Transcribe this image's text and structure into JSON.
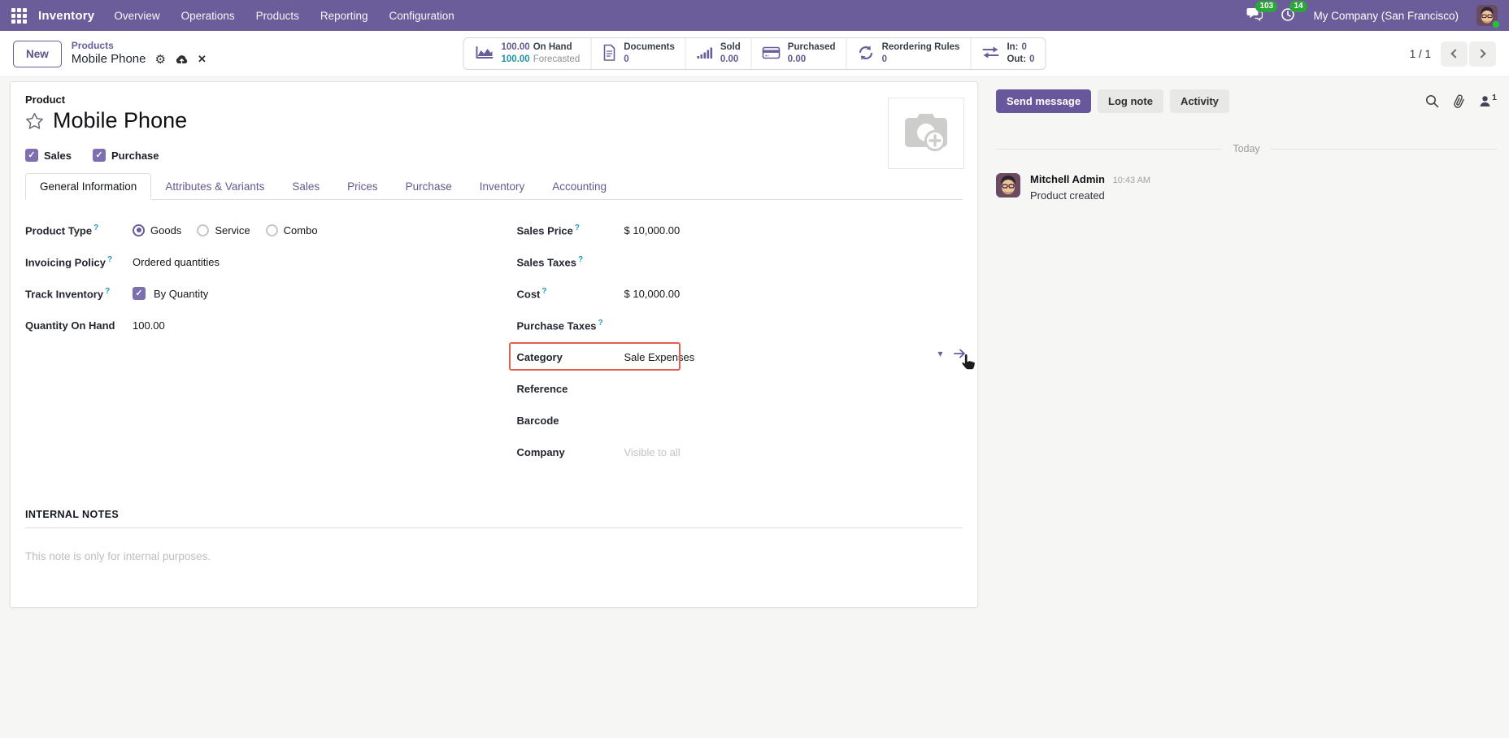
{
  "navbar": {
    "app_name": "Inventory",
    "menu_items": [
      "Overview",
      "Operations",
      "Products",
      "Reporting",
      "Configuration"
    ],
    "messages_badge": "103",
    "activities_badge": "14",
    "company_name": "My Company (San Francisco)"
  },
  "control_panel": {
    "new_button": "New",
    "breadcrumb": {
      "parent": "Products",
      "current": "Mobile Phone"
    },
    "pager": "1 / 1"
  },
  "stat_buttons": {
    "on_hand": {
      "value": "100.00",
      "label": "On Hand",
      "value2": "100.00",
      "label2": "Forecasted"
    },
    "documents": {
      "label": "Documents",
      "value": "0"
    },
    "sold": {
      "label": "Sold",
      "value": "0.00"
    },
    "purchased": {
      "label": "Purchased",
      "value": "0.00"
    },
    "reordering": {
      "label": "Reordering Rules",
      "value": "0"
    },
    "inout": {
      "in_label": "In:",
      "in_value": "0",
      "out_label": "Out:",
      "out_value": "0"
    }
  },
  "form": {
    "record_type": "Product",
    "title": "Mobile Phone",
    "toggles": {
      "sales": "Sales",
      "purchase": "Purchase"
    },
    "tabs": [
      "General Information",
      "Attributes & Variants",
      "Sales",
      "Prices",
      "Purchase",
      "Inventory",
      "Accounting"
    ],
    "fields": {
      "product_type": {
        "label": "Product Type",
        "options": [
          "Goods",
          "Service",
          "Combo"
        ]
      },
      "invoicing_policy": {
        "label": "Invoicing Policy",
        "value": "Ordered quantities"
      },
      "track_inventory": {
        "label": "Track Inventory",
        "value": "By Quantity"
      },
      "qty_on_hand": {
        "label": "Quantity On Hand",
        "value": "100.00"
      },
      "sales_price": {
        "label": "Sales Price",
        "value": "$ 10,000.00"
      },
      "sales_taxes": {
        "label": "Sales Taxes"
      },
      "cost": {
        "label": "Cost",
        "value": "$ 10,000.00"
      },
      "purchase_taxes": {
        "label": "Purchase Taxes"
      },
      "category": {
        "label": "Category",
        "value": "Sale Expenses"
      },
      "reference": {
        "label": "Reference"
      },
      "barcode": {
        "label": "Barcode"
      },
      "company": {
        "label": "Company",
        "placeholder": "Visible to all"
      }
    },
    "notes": {
      "heading": "INTERNAL NOTES",
      "placeholder": "This note is only for internal purposes."
    }
  },
  "chatter": {
    "send_message": "Send message",
    "log_note": "Log note",
    "activity": "Activity",
    "followers_count": "1",
    "date_divider": "Today",
    "message": {
      "author": "Mitchell Admin",
      "time": "10:43 AM",
      "body": "Product created"
    }
  },
  "colors": {
    "primary_purple": "#6b5c9a",
    "teal_info": "#1f93a8",
    "highlight_red": "#e3604f",
    "badge_green": "#2aa63a"
  }
}
